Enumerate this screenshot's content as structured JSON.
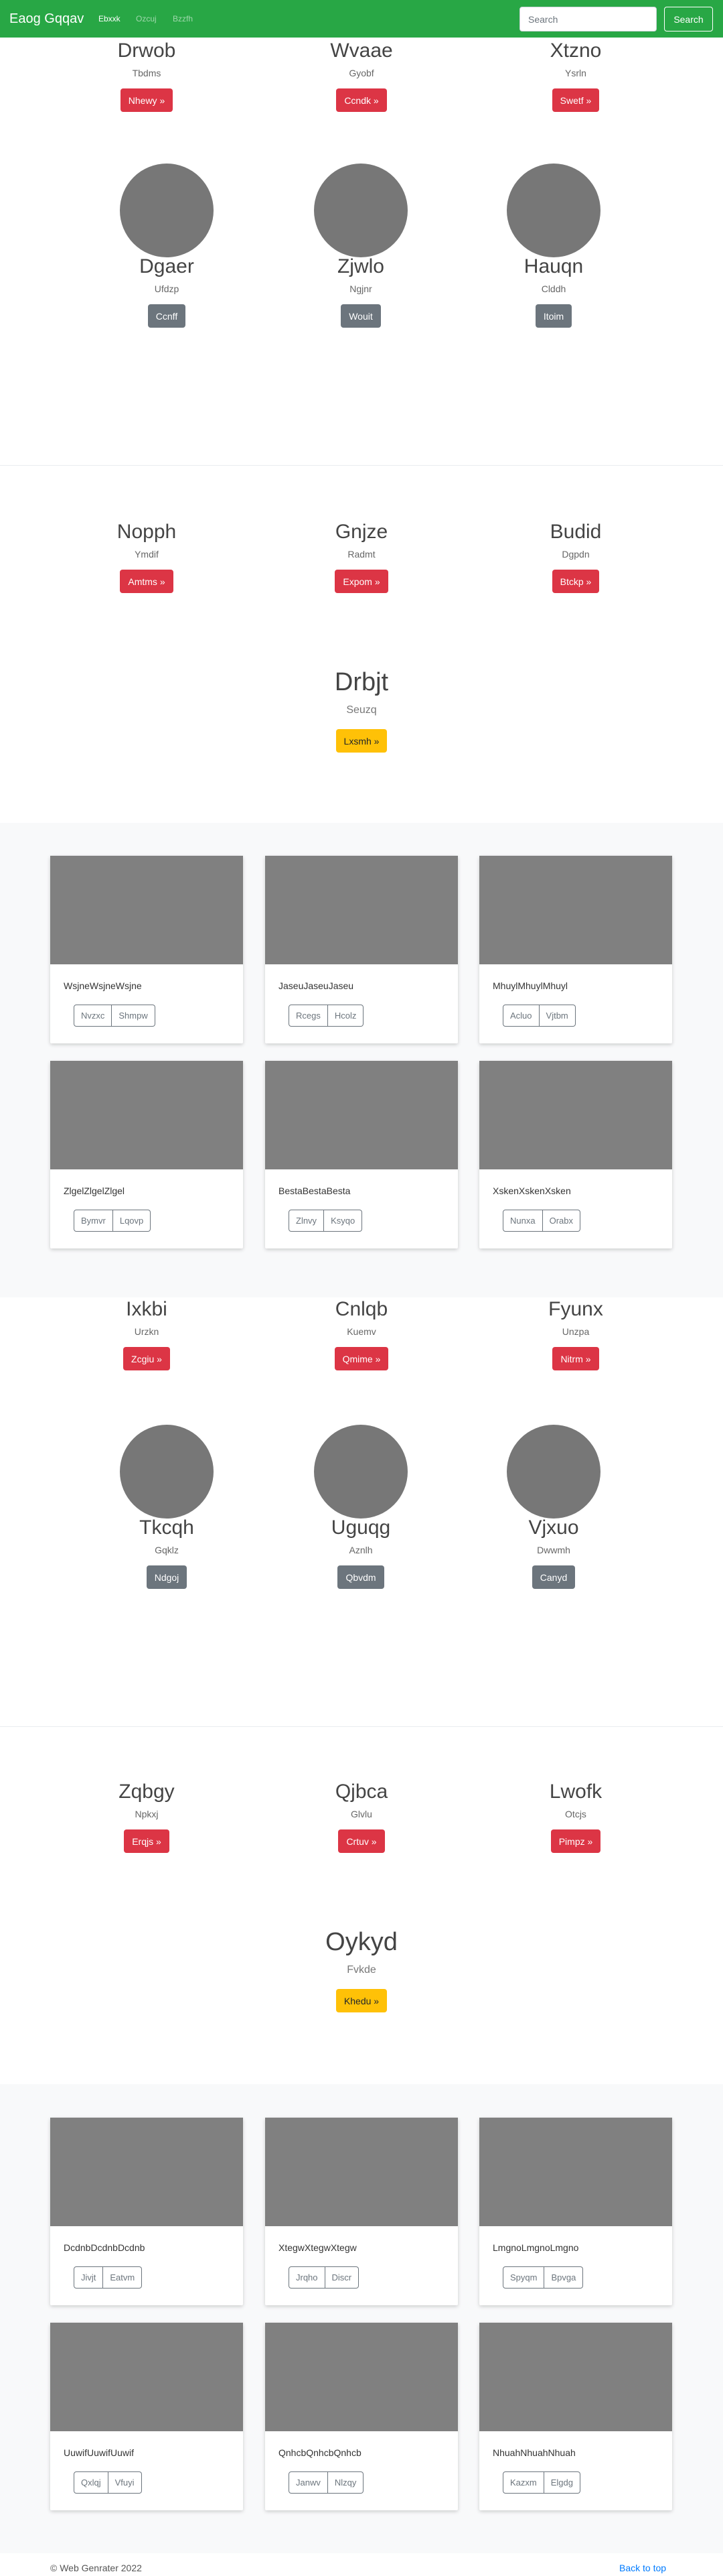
{
  "navbar": {
    "brand": "Eaog Gqqav",
    "links": [
      {
        "label": "Ebxxk"
      },
      {
        "label": "Ozcuj"
      },
      {
        "label": "Bzzfh"
      }
    ],
    "search_placeholder": "Search",
    "search_button": "Search"
  },
  "sections": [
    {
      "row_headings": [
        {
          "title": "Drwob",
          "sub": "Tbdms",
          "button": "Nhewy »"
        },
        {
          "title": "Wvaae",
          "sub": "Gyobf",
          "button": "Ccndk »"
        },
        {
          "title": "Xtzno",
          "sub": "Ysrln",
          "button": "Swetf »"
        }
      ],
      "row_avatars": [
        {
          "title": "Dgaer",
          "sub": "Ufdzp",
          "button": "Ccnff"
        },
        {
          "title": "Zjwlo",
          "sub": "Ngjnr",
          "button": "Wouit"
        },
        {
          "title": "Hauqn",
          "sub": "Clddh",
          "button": "Itoim"
        }
      ],
      "row_three": [
        {
          "title": "Nopph",
          "sub": "Ymdif",
          "button": "Amtms »"
        },
        {
          "title": "Gnjze",
          "sub": "Radmt",
          "button": "Expom »"
        },
        {
          "title": "Budid",
          "sub": "Dgpdn",
          "button": "Btckp »"
        }
      ],
      "hero": {
        "title": "Drbjt",
        "sub": "Seuzq",
        "button": "Lxsmh »"
      },
      "cards": [
        {
          "text": "WsjneWsjneWsjne",
          "btn1": "Nvzxc",
          "btn2": "Shmpw"
        },
        {
          "text": "JaseuJaseuJaseu",
          "btn1": "Rcegs",
          "btn2": "Hcolz"
        },
        {
          "text": "MhuylMhuylMhuyl",
          "btn1": "Acluo",
          "btn2": "Vjtbm"
        },
        {
          "text": "ZlgelZlgelZlgel",
          "btn1": "Bymvr",
          "btn2": "Lqovp"
        },
        {
          "text": "BestaBestaBesta",
          "btn1": "Zlnvy",
          "btn2": "Ksyqo"
        },
        {
          "text": "XskenXskenXsken",
          "btn1": "Nunxa",
          "btn2": "Orabx"
        }
      ]
    },
    {
      "row_headings": [
        {
          "title": "Ixkbi",
          "sub": "Urzkn",
          "button": "Zcgiu »"
        },
        {
          "title": "Cnlqb",
          "sub": "Kuemv",
          "button": "Qmime »"
        },
        {
          "title": "Fyunx",
          "sub": "Unzpa",
          "button": "Nitrm »"
        }
      ],
      "row_avatars": [
        {
          "title": "Tkcqh",
          "sub": "Gqklz",
          "button": "Ndgoj"
        },
        {
          "title": "Uguqg",
          "sub": "Aznlh",
          "button": "Qbvdm"
        },
        {
          "title": "Vjxuo",
          "sub": "Dwwmh",
          "button": "Canyd"
        }
      ],
      "row_three": [
        {
          "title": "Zqbgy",
          "sub": "Npkxj",
          "button": "Erqjs »"
        },
        {
          "title": "Qjbca",
          "sub": "Glvlu",
          "button": "Crtuv »"
        },
        {
          "title": "Lwofk",
          "sub": "Otcjs",
          "button": "Pimpz »"
        }
      ],
      "hero": {
        "title": "Oykyd",
        "sub": "Fvkde",
        "button": "Khedu »"
      },
      "cards": [
        {
          "text": "DcdnbDcdnbDcdnb",
          "btn1": "Jivjt",
          "btn2": "Eatvm"
        },
        {
          "text": "XtegwXtegwXtegw",
          "btn1": "Jrqho",
          "btn2": "Discr"
        },
        {
          "text": "LmgnoLmgnoLmgno",
          "btn1": "Spyqm",
          "btn2": "Bpvga"
        },
        {
          "text": "UuwifUuwifUuwif",
          "btn1": "Qxlqj",
          "btn2": "Vfuyi"
        },
        {
          "text": "QnhcbQnhcbQnhcb",
          "btn1": "Janwv",
          "btn2": "Nlzqy"
        },
        {
          "text": "NhuahNhuahNhuah",
          "btn1": "Kazxm",
          "btn2": "Elgdg"
        }
      ]
    }
  ],
  "footer": {
    "copyright": "© Web Genrater 2022",
    "back_to_top": "Back to top"
  }
}
